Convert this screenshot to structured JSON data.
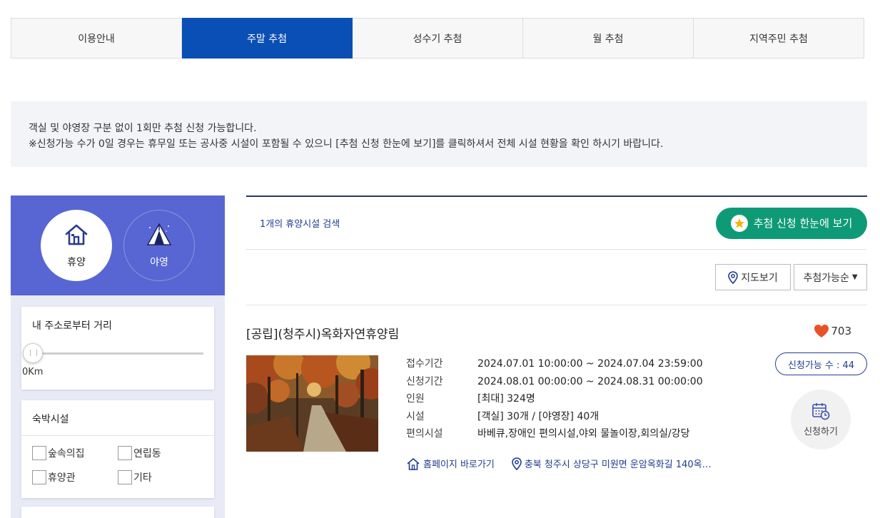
{
  "tabs": [
    {
      "label": "이용안내"
    },
    {
      "label": "주말 추첨"
    },
    {
      "label": "성수기 추첨"
    },
    {
      "label": "월 추첨"
    },
    {
      "label": "지역주민 추첨"
    }
  ],
  "notice": {
    "line1": "객실 및 야영장 구분 없이 1회만 추첨 신청 가능합니다.",
    "line2": "※신청가능 수가 0일 경우는 휴무일 또는 공사중 시설이 포함될 수 있으니 [추첨 신청 한눈에 보기]를 클릭하셔서 전체 시설 현황을 확인 하시기 바랍니다."
  },
  "types": [
    {
      "label": "휴양",
      "icon": "house-icon"
    },
    {
      "label": "야영",
      "icon": "tent-icon"
    }
  ],
  "distance": {
    "title": "내 주소로부터 거리",
    "value": "0Km"
  },
  "facilities": {
    "title": "숙박시설",
    "options": [
      "숲속의집",
      "연립동",
      "휴양관",
      "기타"
    ]
  },
  "results": {
    "count_text": "1개의 휴양시설 검색",
    "view_all": "추첨 신청 한눈에 보기",
    "map_button": "지도보기",
    "sort_selected": "추첨가능순"
  },
  "item": {
    "title": "[공립](청주시)옥화자연휴양림",
    "likes": "703",
    "labels": [
      "접수기간",
      "신청기간",
      "인원",
      "시설",
      "편의시설"
    ],
    "values": [
      "2024.07.01 10:00:00 ~ 2024.07.04 23:59:00",
      "2024.08.01 00:00:00 ~ 2024.08.31 00:00:00",
      "[최대] 324명",
      "[객실] 30개 / [야영장] 40개",
      "바베큐,장애인 편의시설,야외 물놀이장,회의실/강당"
    ],
    "homepage_link": "홈페이지 바로가기",
    "address": "충북 청주시 상당구 미원면 운암옥화길 140옥…",
    "availability": "신청가능 수 : 44",
    "apply": "신청하기"
  },
  "colors": {
    "tab_active": "#0a4fb5",
    "panel_blue": "#5766d2",
    "green_button": "#0f9a77",
    "heart": "#e8522a",
    "navy_line": "#2a3563"
  }
}
